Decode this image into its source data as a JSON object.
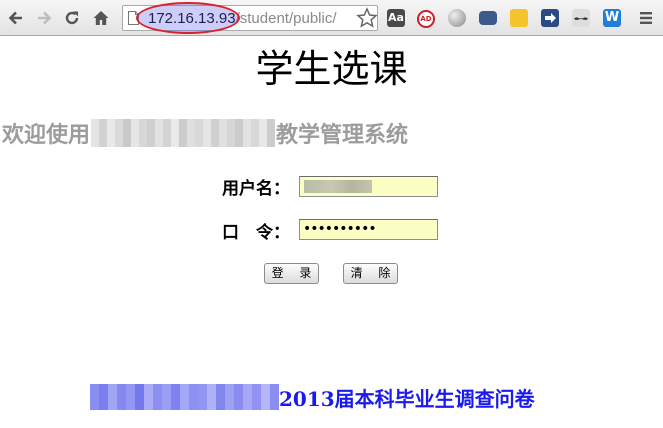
{
  "browser": {
    "url_host": "172.16.13.93",
    "url_path": "/student/public/",
    "extensions": [
      "dictionary-icon",
      "adblock-icon",
      "globe-icon",
      "camera-icon",
      "puzzle-icon",
      "arrow-right-icon",
      "mustache-icon",
      "w-icon"
    ],
    "ext_labels": {
      "dictionary": "Aa",
      "adblock": "AD",
      "w": "W"
    }
  },
  "page": {
    "title": "学生选课",
    "welcome_prefix": "欢迎使用",
    "welcome_suffix": "教学管理系统",
    "username_label": "用户名：",
    "password_label": "口　令：",
    "password_value": "••••••••••",
    "login_button": "登 录",
    "clear_button": "清 除",
    "survey_link": "2013届本科毕业生调查问卷"
  },
  "colors": {
    "input_bg": "#fbffc3",
    "link_blue": "#1a1aee",
    "welcome_gray": "#9c9c9c",
    "highlight_red": "#d8232a"
  }
}
